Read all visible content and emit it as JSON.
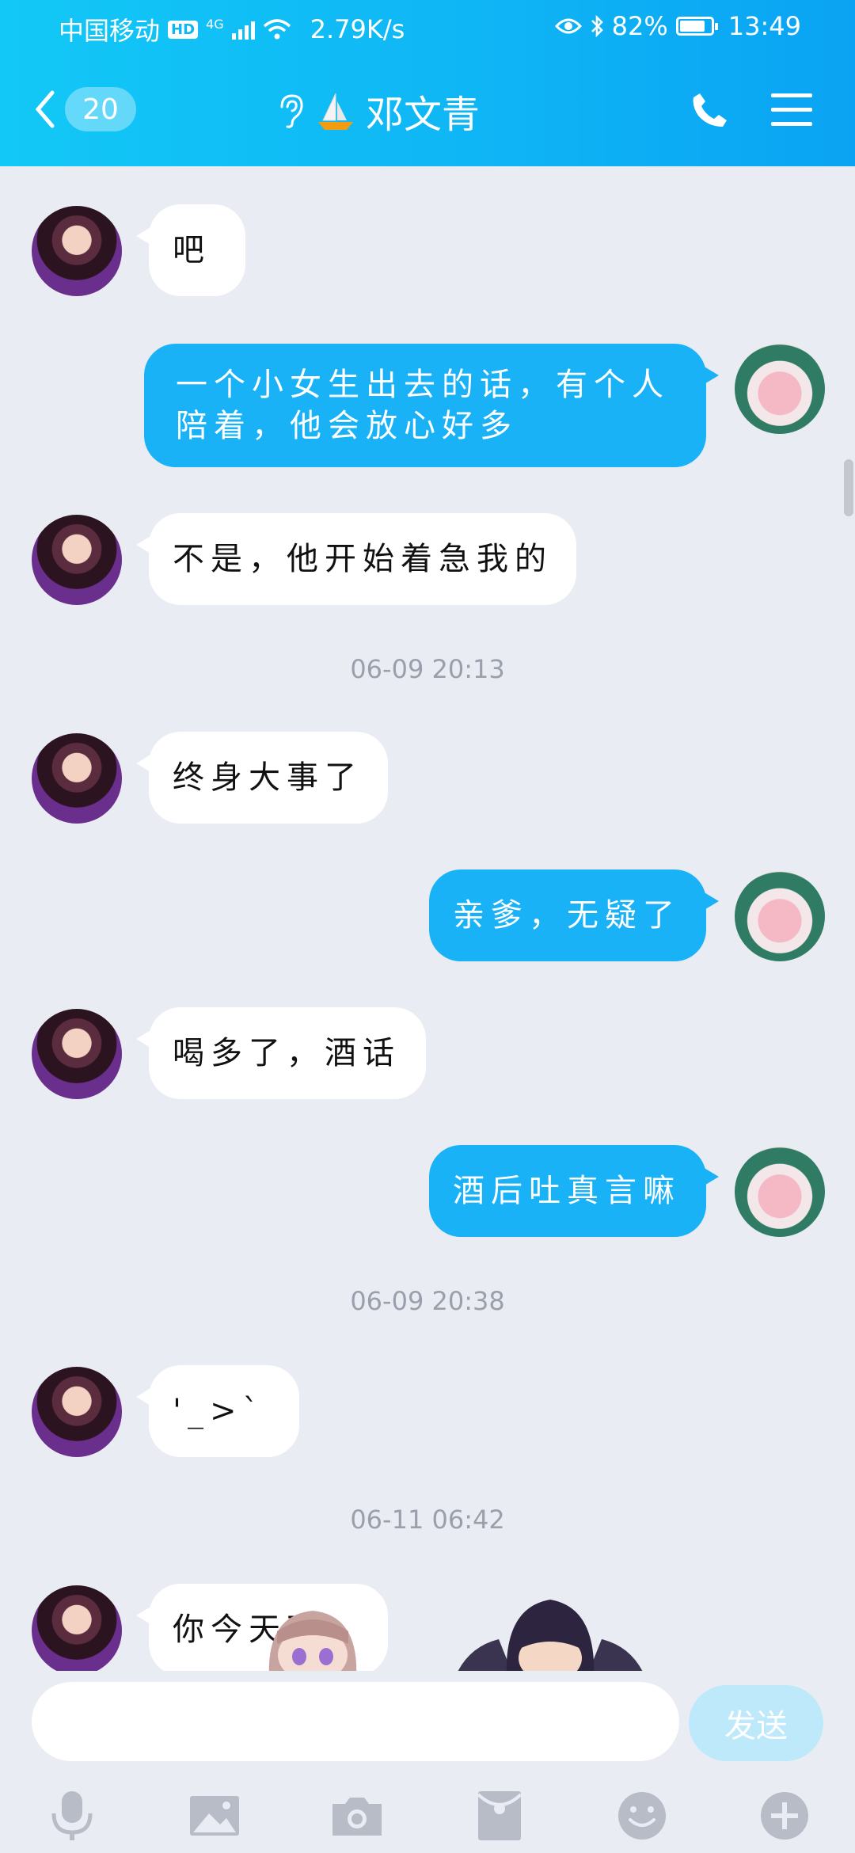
{
  "status_bar": {
    "carrier": "中国移动",
    "hd": "HD",
    "network": "4G",
    "speed": "2.79K/s",
    "battery": "82%",
    "battery_level": 0.82,
    "time": "13:49"
  },
  "nav": {
    "unread_count": "20",
    "contact_name": "邓文青",
    "icons": [
      "back-chevron-icon",
      "ear-icon",
      "sailboat-icon",
      "phone-icon",
      "menu-icon"
    ]
  },
  "messages": [
    {
      "from": "contact",
      "text": "吧"
    },
    {
      "from": "me",
      "text": "一个小女生出去的话，有个人陪着，他会放心好多"
    },
    {
      "from": "contact",
      "text": "不是，他开始着急我的"
    },
    {
      "timestamp": "06-09 20:13"
    },
    {
      "from": "contact",
      "text": "终身大事了"
    },
    {
      "from": "me",
      "text": "亲爹，无疑了"
    },
    {
      "from": "contact",
      "text": "喝多了，酒话"
    },
    {
      "from": "me",
      "text": "酒后吐真言嘛"
    },
    {
      "timestamp": "06-09 20:38"
    },
    {
      "from": "contact",
      "text": "'_>`"
    },
    {
      "timestamp": "06-11 06:42"
    },
    {
      "from": "contact",
      "text": "你今天可"
    }
  ],
  "input": {
    "value": "",
    "send_label": "发送"
  },
  "toolbar": [
    "microphone-icon",
    "image-icon",
    "camera-icon",
    "red-packet-icon",
    "emoji-icon",
    "plus-icon"
  ],
  "colors": {
    "header_start": "#12c8f6",
    "header_end": "#0aa3f3",
    "outgoing_bubble": "#1ab2f7",
    "incoming_bubble": "#ffffff",
    "chat_background": "#eaecf3",
    "send_button": "#bde9fa",
    "timestamp_text": "#9aa0ab"
  }
}
